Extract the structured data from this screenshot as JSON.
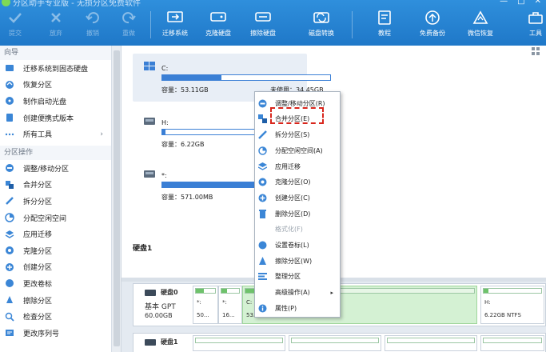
{
  "titlebar": {
    "title": "分区助手专业版 - 无损分区免费软件",
    "controls": [
      "—",
      "□",
      "✕"
    ]
  },
  "toolbar": {
    "submit": "提交",
    "discard": "放弃",
    "undo": "撤销",
    "redo": "重做",
    "migrate": "迁移系统",
    "clone_disk": "克隆硬盘",
    "wipe_disk": "擦除硬盘",
    "disk_convert": "磁盘转换",
    "tutorial": "教程",
    "free_backup": "免费备份",
    "wechat_recovery": "微信恢复",
    "tools": "工具"
  },
  "sidebar": {
    "wizard_title": "向导",
    "wizard_items": [
      {
        "label": "迁移系统到固态硬盘",
        "icon": "migrate-icon"
      },
      {
        "label": "恢复分区",
        "icon": "recover-icon"
      },
      {
        "label": "制作启动光盘",
        "icon": "boot-disc-icon"
      },
      {
        "label": "创建便携式版本",
        "icon": "portable-icon"
      },
      {
        "label": "所有工具",
        "icon": "tools-icon"
      }
    ],
    "ops_title": "分区操作",
    "ops_items": [
      {
        "label": "调整/移动分区",
        "icon": "resize-icon"
      },
      {
        "label": "合并分区",
        "icon": "merge-icon"
      },
      {
        "label": "拆分分区",
        "icon": "split-icon"
      },
      {
        "label": "分配空闲空间",
        "icon": "allocate-icon"
      },
      {
        "label": "应用迁移",
        "icon": "app-migrate-icon"
      },
      {
        "label": "克隆分区",
        "icon": "clone-icon"
      },
      {
        "label": "创建分区",
        "icon": "create-icon"
      },
      {
        "label": "更改卷标",
        "icon": "label-icon"
      },
      {
        "label": "擦除分区",
        "icon": "wipe-icon"
      },
      {
        "label": "检查分区",
        "icon": "check-icon"
      },
      {
        "label": "更改序列号",
        "icon": "serial-icon"
      }
    ]
  },
  "partitions": [
    {
      "name": "C:",
      "capacity": "容量：53.11GB",
      "unused": "未使用：34.45GB",
      "used_fraction": 0.35
    },
    {
      "name": "H:",
      "capacity": "容量：6.22GB",
      "unused": "",
      "used_fraction": 0.02
    },
    {
      "name": "*:",
      "capacity": "容量：571.00MB",
      "unused": "",
      "used_fraction": 0.55
    }
  ],
  "disk1_label": "硬盘1",
  "diskmap": {
    "disk0": {
      "name": "硬盘0",
      "type": "基本 GPT",
      "size": "60.00GB"
    },
    "disk0_parts": [
      {
        "name": "*:",
        "size": "50..."
      },
      {
        "name": "*:",
        "size": "16..."
      },
      {
        "name": "C:",
        "size": "53.1"
      },
      {
        "name": "H:",
        "size": "6.22GB NTFS"
      }
    ],
    "disk1": {
      "name": "硬盘1"
    }
  },
  "context_menu": [
    {
      "label": "调整/移动分区(R)",
      "icon": "resize-icon",
      "enabled": true
    },
    {
      "label": "合并分区(E)",
      "icon": "merge-icon",
      "enabled": true
    },
    {
      "label": "拆分分区(S)",
      "icon": "split-icon",
      "enabled": true
    },
    {
      "label": "分配空闲空间(A)",
      "icon": "allocate-icon",
      "enabled": true
    },
    {
      "label": "应用迁移",
      "icon": "app-migrate-icon",
      "enabled": true
    },
    {
      "label": "克隆分区(O)",
      "icon": "clone-icon",
      "enabled": true
    },
    {
      "label": "创建分区(C)",
      "icon": "create-icon",
      "enabled": true
    },
    {
      "label": "删除分区(D)",
      "icon": "delete-icon",
      "enabled": true
    },
    {
      "label": "格式化(F)",
      "icon": "",
      "enabled": false
    },
    {
      "label": "设置卷标(L)",
      "icon": "label-icon",
      "enabled": true
    },
    {
      "label": "擦除分区(W)",
      "icon": "wipe-icon",
      "enabled": true
    },
    {
      "label": "整理分区",
      "icon": "defrag-icon",
      "enabled": true
    },
    {
      "label": "高级操作(A)",
      "icon": "",
      "enabled": true,
      "submenu": "▸"
    },
    {
      "label": "属性(P)",
      "icon": "info-icon",
      "enabled": true
    }
  ],
  "colors": {
    "accent": "#1f78c8",
    "bar": "#3a7fd5",
    "highlight": "#d8261c",
    "selected_part": "#d4f1d3"
  }
}
